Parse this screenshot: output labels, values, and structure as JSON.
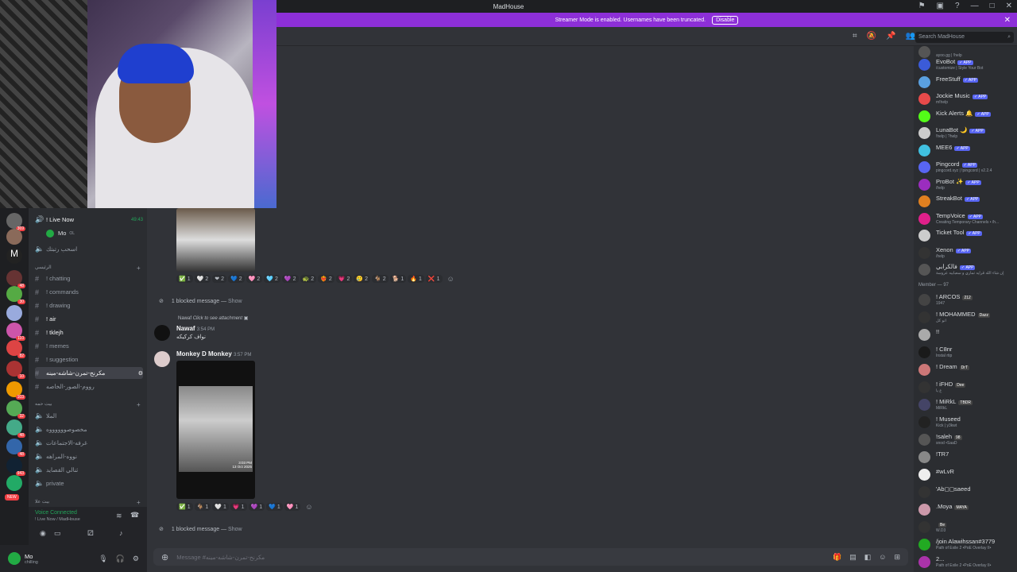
{
  "titlebar": {
    "title": "MadHouse"
  },
  "banner": {
    "text": "Streamer Mode is enabled. Usernames have been truncated.",
    "disable_label": "Disable"
  },
  "search": {
    "placeholder": "Search MadHouse"
  },
  "servers": {
    "badges": [
      "369",
      "48",
      "30",
      "1",
      "110",
      "82",
      "10",
      "103",
      "32",
      "48",
      "48",
      "943"
    ],
    "new_label": "NEW"
  },
  "channels": {
    "live": {
      "name": "! Live Now",
      "time": "49:43",
      "user": "Mo",
      "user_tag": "OL"
    },
    "items": [
      {
        "name": "اسحب رتبتك",
        "type": "voice"
      },
      {
        "name": "الرئيسي",
        "type": "category"
      },
      {
        "name": "! chatting"
      },
      {
        "name": "! commands"
      },
      {
        "name": "! drawing"
      },
      {
        "name": "! air"
      },
      {
        "name": "! tklejh"
      },
      {
        "name": "! memes"
      },
      {
        "name": "! suggestion"
      },
      {
        "name": "مكرنح-تمرن-شاشه-مينه",
        "active": true
      },
      {
        "name": "رووم-الصور-الخاصه"
      },
      {
        "name": "بيت حمه",
        "type": "category"
      },
      {
        "name": "الملا",
        "type": "voice"
      },
      {
        "name": "مخصوصووووووه",
        "type": "voice"
      },
      {
        "name": "غرفه-الاجتماعات",
        "type": "voice"
      },
      {
        "name": "نووه-المراهه",
        "type": "voice"
      },
      {
        "name": "ثنالي القصايد",
        "type": "voice"
      },
      {
        "name": "private",
        "type": "voice"
      },
      {
        "name": "بيت علا",
        "type": "category"
      }
    ]
  },
  "voice": {
    "status": "Voice Connected",
    "location": "! Live Now / MadHouse"
  },
  "user": {
    "name": "Mo",
    "status": "chilling"
  },
  "messages": {
    "reactions1": [
      {
        "emoji": "✅",
        "count": "1"
      },
      {
        "emoji": "🤍",
        "count": "2"
      },
      {
        "emoji": "❤",
        "count": "2"
      },
      {
        "emoji": "💙",
        "count": "2"
      },
      {
        "emoji": "🩷",
        "count": "2"
      },
      {
        "emoji": "🩵",
        "count": "2"
      },
      {
        "emoji": "💜",
        "count": "2"
      },
      {
        "emoji": "🐢",
        "count": "2"
      },
      {
        "emoji": "❤‍🔥",
        "count": "2"
      },
      {
        "emoji": "💗",
        "count": "2"
      },
      {
        "emoji": "🥲",
        "count": "2"
      },
      {
        "emoji": "🐐",
        "count": "2"
      },
      {
        "emoji": "🐕",
        "count": "1"
      },
      {
        "emoji": "🔥",
        "count": "1"
      },
      {
        "emoji": "❌",
        "count": "1"
      }
    ],
    "blocked1": "1 blocked message —",
    "show": "Show",
    "reply_name": "Nawaf",
    "reply_text": "Click to see attachment",
    "nawaf": {
      "name": "Nawaf",
      "time": "3:54 PM",
      "text": "نواف كركيكه"
    },
    "monkey": {
      "name": "Monkey D Monkey",
      "time": "3:57 PM",
      "img_time": "3:03 PM",
      "img_date": "13 Oct 2025"
    },
    "reactions2": [
      {
        "emoji": "✅",
        "count": "1"
      },
      {
        "emoji": "🐐",
        "count": "1"
      },
      {
        "emoji": "🤍",
        "count": "1"
      },
      {
        "emoji": "💗",
        "count": "1"
      },
      {
        "emoji": "💜",
        "count": "1"
      },
      {
        "emoji": "💙",
        "count": "1"
      },
      {
        "emoji": "🩷",
        "count": "1"
      }
    ],
    "blocked2": "1 blocked message —"
  },
  "composer": {
    "placeholder": "Message #مكرنح-تمرن-شاشه-مينه"
  },
  "members": {
    "bots": [
      {
        "name": "",
        "status": "ayoo.gg | !help"
      },
      {
        "name": "EvoBot",
        "status": "/customize | Style Your Bot",
        "color": "#3b5bd8"
      },
      {
        "name": "FreeStuff",
        "status": "",
        "color": "#5aa0e0"
      },
      {
        "name": "Jockie Music",
        "status": "m!help",
        "color": "#e84a4a"
      },
      {
        "name": "Kick Alerts 🔔",
        "status": "",
        "color": "#53fc18"
      },
      {
        "name": "LunaBot 🌙",
        "status": "!help | ?help",
        "color": "#ccc"
      },
      {
        "name": "MEE6",
        "status": "",
        "color": "#40c0e0"
      },
      {
        "name": "Pingcord",
        "status": "pingcord.xyz | !pingcord | v2.2.4",
        "color": "#5865f2"
      },
      {
        "name": "ProBot ✨",
        "status": "/help",
        "color": "#9b2dbf"
      },
      {
        "name": "StreakBot",
        "status": "",
        "color": "#e08020"
      },
      {
        "name": "TempVoice",
        "status": "Creating Temporary Channels • /h...",
        "color": "#e0208a"
      },
      {
        "name": "Ticket Tool",
        "status": "",
        "color": "#cccccc"
      },
      {
        "name": "Xenon",
        "status": "/help",
        "color": "#333"
      },
      {
        "name": "فالكرابي",
        "status": "إن شاء الله قرايه تماري و سعبابيه عروسة",
        "color": "#555"
      }
    ],
    "header": "Member — 97",
    "users": [
      {
        "name": "! ARCOS",
        "tag": "212",
        "status": "1947",
        "color": "#444"
      },
      {
        "name": "! MOHAMMED",
        "tag": "Dazz",
        "status": "انو كل",
        "color": "#333"
      },
      {
        "name": "!!",
        "status": "",
        "color": "#aaa"
      },
      {
        "name": "! C8nr",
        "status": "Instal rtip",
        "color": "#1a1a1a"
      },
      {
        "name": "! Dream",
        "tag": "DrT",
        "status": "",
        "color": "#c77"
      },
      {
        "name": "! iFHD",
        "tag": "Dee",
        "status": "ع يا",
        "color": "#333"
      },
      {
        "name": "! MiRkL",
        "tag": "TBDR",
        "status": "MiRkL",
        "color": "#446"
      },
      {
        "name": "! Museed",
        "status": "Kick | y3kwt",
        "color": "#222"
      },
      {
        "name": "!saleh",
        "tag": "98",
        "status": "snod •SaaD",
        "color": "#555"
      },
      {
        "name": "!TR7",
        "status": "",
        "color": "#888"
      },
      {
        "name": "#wLvR",
        "status": "",
        "color": "#eee"
      },
      {
        "name": "'Ab◻◻saeed",
        "status": "",
        "color": "#333"
      },
      {
        "name": ".Moya",
        "tag": "MAYA",
        "status": "",
        "color": "#c9a"
      },
      {
        "name": "",
        "tag": "Be",
        "status": "W.D3",
        "color": "#333"
      },
      {
        "name": "/join Alawihssan#3779",
        "status": "Path of Exile 2 •PoE Overlay II•",
        "color": "#2a2"
      },
      {
        "name": "2...",
        "status": "Path of Exile 2 •PoE Overlay II•",
        "color": "#a3a"
      }
    ]
  }
}
